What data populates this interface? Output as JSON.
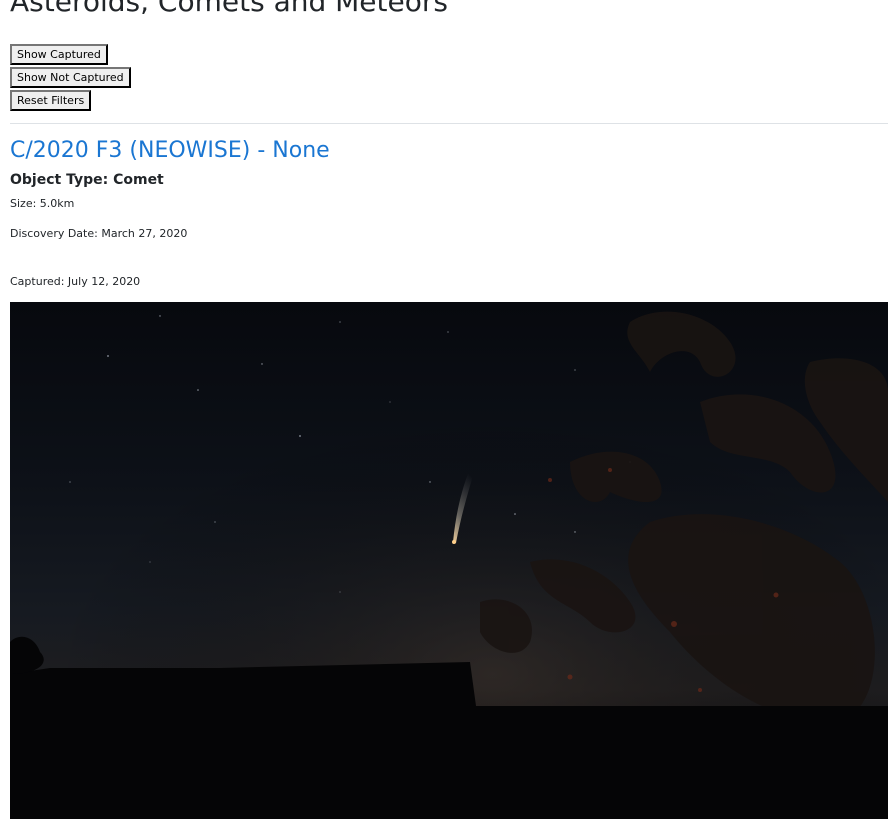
{
  "page": {
    "title": "Asteroids, Comets and Meteors"
  },
  "filters": {
    "show_captured": "Show Captured",
    "show_not_captured": "Show Not Captured",
    "reset": "Reset Filters"
  },
  "object": {
    "title": "C/2020 F3 (NEOWISE) - None",
    "type_line": "Object Type: Comet",
    "size_line": "Size: 5.0km",
    "discovery_line": "Discovery Date: March 27, 2020",
    "captured_line": "Captured: July 12, 2020"
  },
  "colors": {
    "link": "#1a76d2",
    "text": "#212529",
    "divider": "#dee2e6"
  }
}
